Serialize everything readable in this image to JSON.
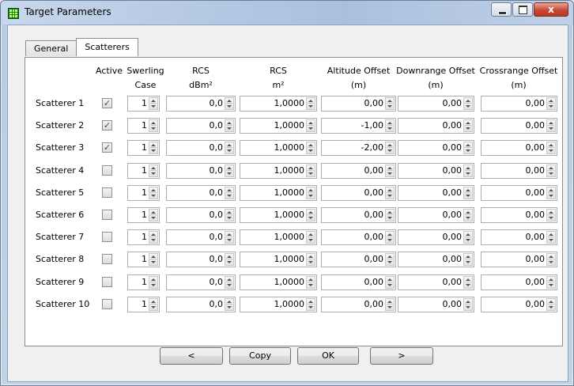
{
  "window": {
    "title": "Target Parameters",
    "controls": {
      "minimize": "minimize",
      "maximize": "maximize",
      "close": "x"
    }
  },
  "tabs": [
    {
      "label": "General",
      "active": false
    },
    {
      "label": "Scatterers",
      "active": true
    }
  ],
  "columns": {
    "active": [
      "Active",
      ""
    ],
    "swerling": [
      "Swerling",
      "Case"
    ],
    "rcs_dbm": [
      "RCS",
      "dBm²"
    ],
    "rcs_m": [
      "RCS",
      "m²"
    ],
    "altitude": [
      "Altitude Offset",
      "(m)"
    ],
    "downrange": [
      "Downrange Offset",
      "(m)"
    ],
    "crossrange": [
      "Crossrange Offset",
      "(m)"
    ]
  },
  "rows": [
    {
      "label": "Scatterer 1",
      "active": true,
      "swerling": "1",
      "rcs_dbm": "0,0",
      "rcs_m": "1,0000",
      "altitude": "0,00",
      "downrange": "0,00",
      "crossrange": "0,00"
    },
    {
      "label": "Scatterer 2",
      "active": true,
      "swerling": "1",
      "rcs_dbm": "0,0",
      "rcs_m": "1,0000",
      "altitude": "-1,00",
      "downrange": "0,00",
      "crossrange": "0,00"
    },
    {
      "label": "Scatterer 3",
      "active": true,
      "swerling": "1",
      "rcs_dbm": "0,0",
      "rcs_m": "1,0000",
      "altitude": "-2,00",
      "downrange": "0,00",
      "crossrange": "0,00"
    },
    {
      "label": "Scatterer 4",
      "active": false,
      "swerling": "1",
      "rcs_dbm": "0,0",
      "rcs_m": "1,0000",
      "altitude": "0,00",
      "downrange": "0,00",
      "crossrange": "0,00"
    },
    {
      "label": "Scatterer 5",
      "active": false,
      "swerling": "1",
      "rcs_dbm": "0,0",
      "rcs_m": "1,0000",
      "altitude": "0,00",
      "downrange": "0,00",
      "crossrange": "0,00"
    },
    {
      "label": "Scatterer 6",
      "active": false,
      "swerling": "1",
      "rcs_dbm": "0,0",
      "rcs_m": "1,0000",
      "altitude": "0,00",
      "downrange": "0,00",
      "crossrange": "0,00"
    },
    {
      "label": "Scatterer 7",
      "active": false,
      "swerling": "1",
      "rcs_dbm": "0,0",
      "rcs_m": "1,0000",
      "altitude": "0,00",
      "downrange": "0,00",
      "crossrange": "0,00"
    },
    {
      "label": "Scatterer 8",
      "active": false,
      "swerling": "1",
      "rcs_dbm": "0,0",
      "rcs_m": "1,0000",
      "altitude": "0,00",
      "downrange": "0,00",
      "crossrange": "0,00"
    },
    {
      "label": "Scatterer 9",
      "active": false,
      "swerling": "1",
      "rcs_dbm": "0,0",
      "rcs_m": "1,0000",
      "altitude": "0,00",
      "downrange": "0,00",
      "crossrange": "0,00"
    },
    {
      "label": "Scatterer 10",
      "active": false,
      "swerling": "1",
      "rcs_dbm": "0,0",
      "rcs_m": "1,0000",
      "altitude": "0,00",
      "downrange": "0,00",
      "crossrange": "0,00"
    }
  ],
  "buttons": {
    "prev": "<",
    "copy": "Copy",
    "ok": "OK",
    "next": ">"
  },
  "colors": {
    "title_bar": "#b7cbe4",
    "close_button": "#c94a33",
    "panel": "#ffffff"
  }
}
